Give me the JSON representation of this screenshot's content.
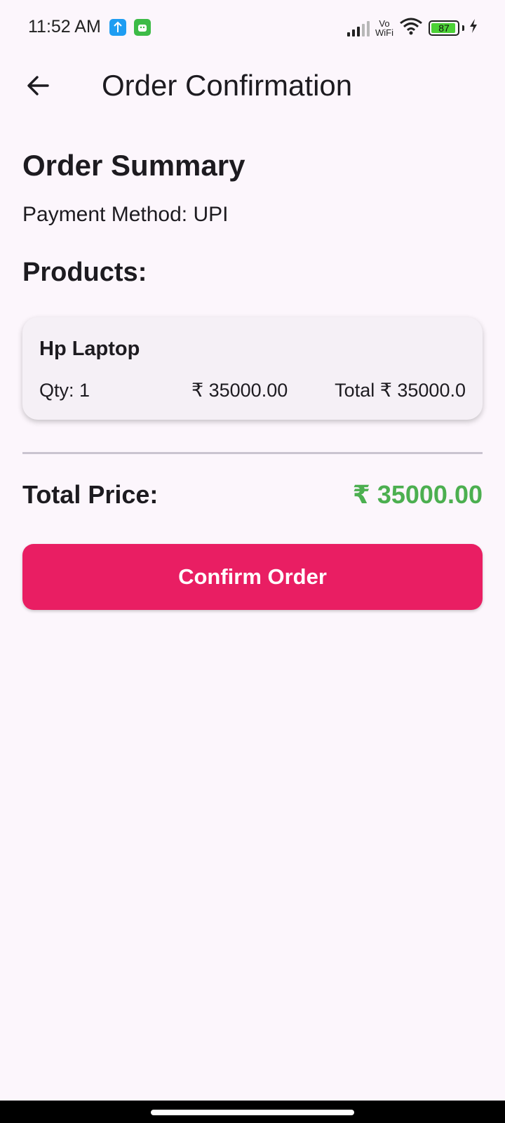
{
  "status_bar": {
    "time": "11:52 AM",
    "vo_line1": "Vo",
    "vo_line2": "WiFi",
    "battery_level": "87",
    "icons": [
      "upload-notification-icon",
      "android-notification-icon",
      "signal-icon",
      "wifi-icon",
      "battery-icon",
      "charging-icon"
    ]
  },
  "app_bar": {
    "title": "Order Confirmation",
    "back_icon": "arrow-left-icon"
  },
  "summary": {
    "title": "Order Summary",
    "payment_method": "Payment Method: UPI",
    "products_title": "Products:"
  },
  "products": [
    {
      "name": "Hp Laptop",
      "qty": "Qty: 1",
      "price": "₹ 35000.00",
      "total": "Total ₹ 35000.0"
    }
  ],
  "total": {
    "label": "Total Price:",
    "value": "₹ 35000.00",
    "value_color": "#4caf50"
  },
  "confirm_button": {
    "label": "Confirm Order",
    "color": "#e91e63"
  }
}
